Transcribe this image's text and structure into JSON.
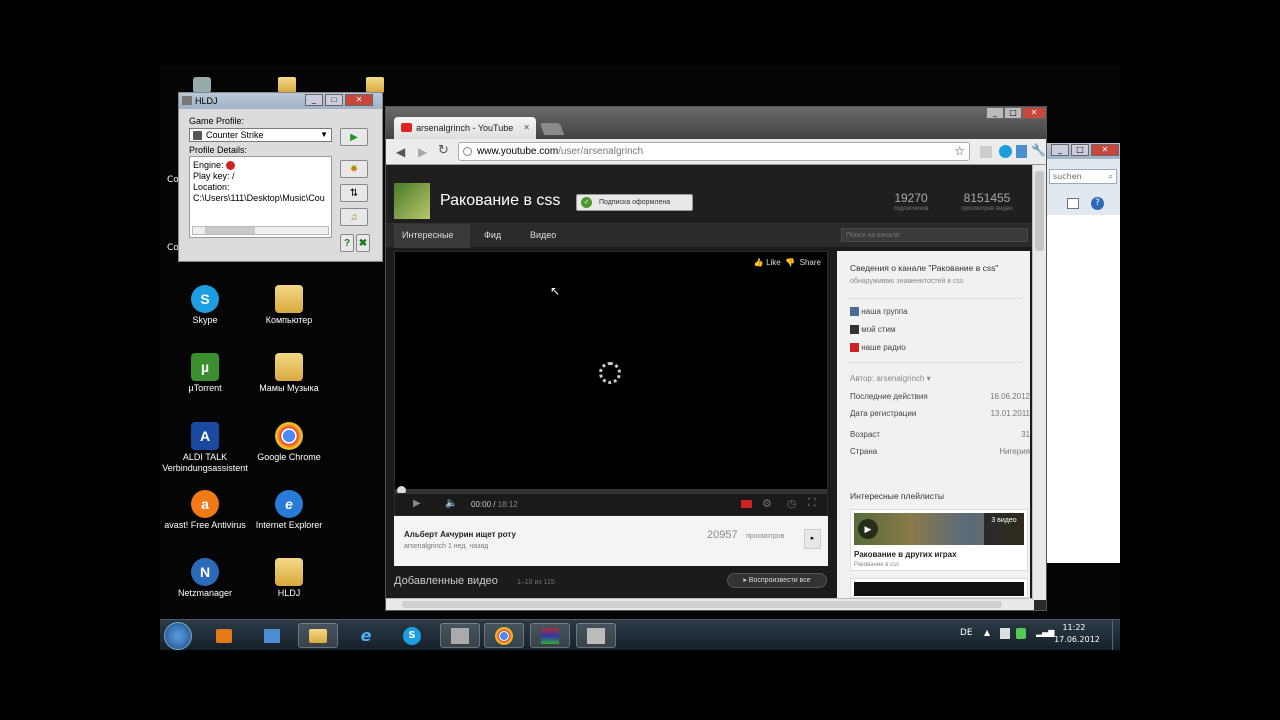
{
  "desktop": {
    "icons": [
      {
        "label": "Skype",
        "glyph": "S",
        "color": "#1c9ee0"
      },
      {
        "label": "Компьютер",
        "glyph": "",
        "color": "folder"
      },
      {
        "label": "µTorrent",
        "glyph": "µ",
        "color": "#3c8f2f"
      },
      {
        "label": "Мамы Музыка",
        "glyph": "",
        "color": "folder"
      },
      {
        "label": "ALDI TALK Verbindungsassistent",
        "glyph": "A",
        "color": "#1a4aa0"
      },
      {
        "label": "Google Chrome",
        "glyph": "●",
        "color": "#2d9b45"
      },
      {
        "label": "avast! Free Antivirus",
        "glyph": "a",
        "color": "#f07a18"
      },
      {
        "label": "Internet Explorer",
        "glyph": "e",
        "color": "#2a7ad8"
      },
      {
        "label": "Netzmanager",
        "glyph": "N",
        "color": "#2a6ab8"
      },
      {
        "label": "HLDJ",
        "glyph": "",
        "color": "folder"
      }
    ],
    "partial_labels": [
      "Co",
      "Co"
    ]
  },
  "hldj": {
    "title": "HLDJ",
    "game_profile_label": "Game Profile:",
    "game_profile_value": "Counter Strike",
    "profile_details_label": "Profile Details:",
    "engine_label": "Engine:",
    "play_key_label": "Play key:",
    "play_key_value": "/",
    "location_label": "Location:",
    "location_value": "C:\\Users\\111\\Desktop\\Music\\Cou"
  },
  "chrome": {
    "tab_title": "arsenalgrinch - YouTube",
    "url_host": "www.youtube.com",
    "url_path": "/user/arsenalgrinch"
  },
  "channel": {
    "name": "Ракование в css",
    "subscribe_status": "Подписка оформлена",
    "subscribers_count": "19270",
    "subscribers_label": "подписчиков",
    "views_count": "8151455",
    "views_label": "просмотров видео",
    "nav_tabs": [
      "Интересные",
      "Фид",
      "Видео"
    ],
    "search_placeholder": "Поиск на канале"
  },
  "player": {
    "like_label": "Like",
    "share_label": "Share",
    "time_current": "00:00",
    "time_total": "18:12"
  },
  "video": {
    "title": "Альберт Акчурин ищет роту",
    "meta": "arsenalgrinch 1 нед. назад",
    "views_count": "20957",
    "views_label": "просмотров"
  },
  "added_videos": {
    "title": "Добавленные видео",
    "range": "1–10 из 115",
    "play_all_label": "Воспроизвести все"
  },
  "sidebar": {
    "about_title": "Сведения о канале \"Ракование в css\"",
    "about_desc": "обнаруживаю знаменитостей в css",
    "links": [
      "наша группа",
      "мой стим",
      "наше радио"
    ],
    "author_label": "Автор: arsenalgrinch",
    "rows": [
      {
        "label": "Последние действия",
        "value": "16.06.2012"
      },
      {
        "label": "Дата регистрации",
        "value": "13.01.2011"
      },
      {
        "label": "Возраст",
        "value": "31"
      },
      {
        "label": "Страна",
        "value": "Нигерия"
      }
    ],
    "playlists_title": "Интересные плейлисты",
    "playlist_name": "Ракование в других играх",
    "playlist_sub": "Ракование в css",
    "playlist_count": "3 видео"
  },
  "right_window": {
    "search_text": "suchen"
  },
  "taskbar": {
    "lang": "DE",
    "time": "11:22",
    "date": "17.06.2012"
  }
}
